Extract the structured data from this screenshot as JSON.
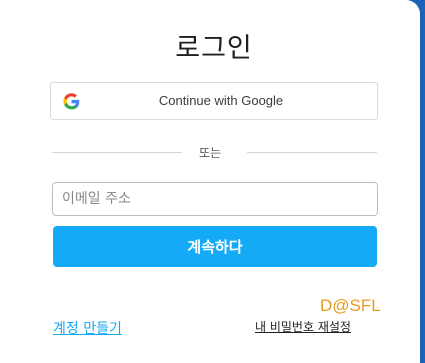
{
  "login": {
    "title": "로그인",
    "google_button_label": "Continue with Google",
    "divider_text": "또는",
    "email_placeholder": "이메일 주소",
    "continue_button_label": "계속하다",
    "watermark_text": "D@SFL",
    "create_account_link": "계정 만들기",
    "forgot_password_link": "내 비밀번호 재설정"
  },
  "colors": {
    "primary_button": "#14aaf5",
    "link": "#14aaf5",
    "watermark": "#e89a1c",
    "background_edge": "#1c63b8"
  },
  "icons": {
    "google": "google-logo-icon"
  }
}
